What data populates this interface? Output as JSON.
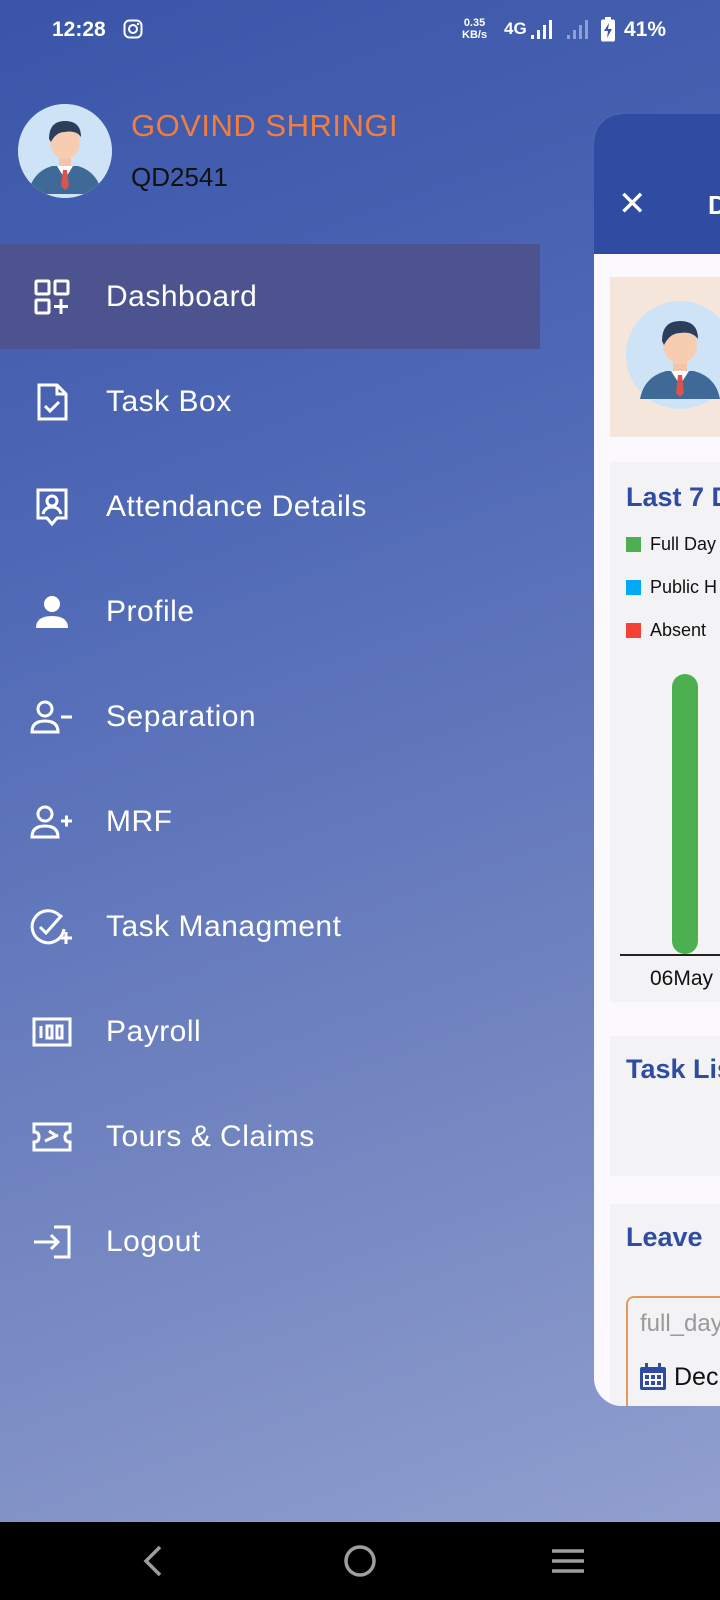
{
  "status_bar": {
    "time": "12:28",
    "net_speed": "0.35",
    "net_speed_unit": "KB/s",
    "network": "4G",
    "battery": "41%"
  },
  "user": {
    "name": "GOVIND SHRINGI",
    "code": "QD2541"
  },
  "menu": {
    "items": [
      {
        "label": "Dashboard",
        "icon": "dashboard-icon",
        "active": true
      },
      {
        "label": "Task Box",
        "icon": "task-box-icon"
      },
      {
        "label": "Attendance Details",
        "icon": "attendance-icon"
      },
      {
        "label": "Profile",
        "icon": "person-icon"
      },
      {
        "label": "Separation",
        "icon": "person-remove-icon"
      },
      {
        "label": "MRF",
        "icon": "person-add-icon"
      },
      {
        "label": "Task Managment",
        "icon": "task-check-icon"
      },
      {
        "label": "Payroll",
        "icon": "payroll-icon"
      },
      {
        "label": "Tours & Claims",
        "icon": "ticket-icon"
      },
      {
        "label": "Logout",
        "icon": "logout-icon"
      }
    ]
  },
  "panel": {
    "header_title": "D",
    "chart_title": "Last 7 D",
    "legend": [
      {
        "label": "Full Day",
        "color": "#4caf50"
      },
      {
        "label": "Public H",
        "color": "#03a9f4"
      },
      {
        "label": "Absent",
        "color": "#f44336"
      }
    ],
    "task_title": "Task Lis",
    "leave_title": "Leave",
    "leave_placeholder": "full_day",
    "leave_date": "Dec"
  },
  "chart_data": {
    "type": "bar",
    "categories": [
      "06May"
    ],
    "series": [
      {
        "name": "Full Day",
        "values": [
          1
        ]
      }
    ],
    "legend": [
      "Full Day",
      "Public H",
      "Absent"
    ],
    "legend_placement": "top-left"
  },
  "colors": {
    "accent": "#2f4ca2",
    "name": "#f47d3b",
    "active_item": "#4c538f"
  }
}
